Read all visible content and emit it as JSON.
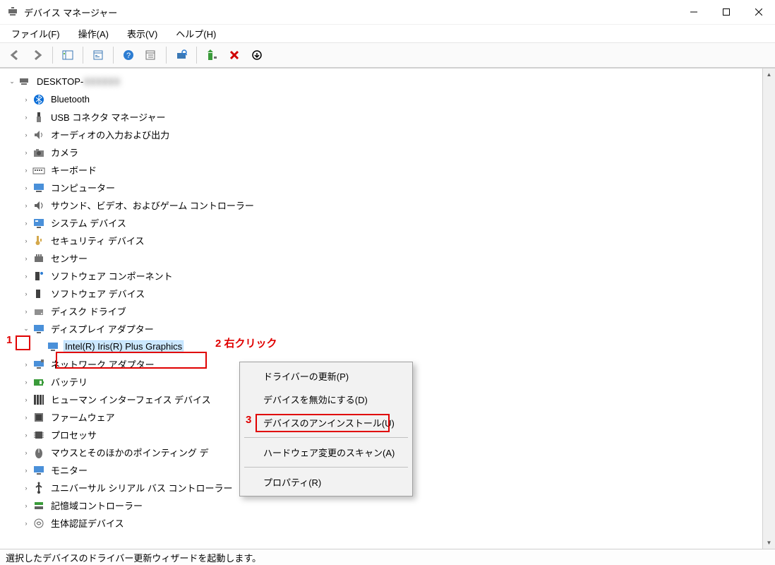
{
  "titlebar": {
    "title": "デバイス マネージャー"
  },
  "menubar": {
    "file": "ファイル(F)",
    "action": "操作(A)",
    "view": "表示(V)",
    "help": "ヘルプ(H)"
  },
  "tree": {
    "root": {
      "label": "DESKTOP-",
      "suffix_hidden": "XXXXXX"
    },
    "items": [
      {
        "label": "Bluetooth",
        "icon": "bluetooth"
      },
      {
        "label": "USB コネクタ マネージャー",
        "icon": "usb"
      },
      {
        "label": "オーディオの入力および出力",
        "icon": "audio"
      },
      {
        "label": "カメラ",
        "icon": "camera"
      },
      {
        "label": "キーボード",
        "icon": "keyboard"
      },
      {
        "label": "コンピューター",
        "icon": "computer"
      },
      {
        "label": "サウンド、ビデオ、およびゲーム コントローラー",
        "icon": "sound"
      },
      {
        "label": "システム デバイス",
        "icon": "system"
      },
      {
        "label": "セキュリティ デバイス",
        "icon": "security"
      },
      {
        "label": "センサー",
        "icon": "sensor"
      },
      {
        "label": "ソフトウェア コンポーネント",
        "icon": "swcomponent"
      },
      {
        "label": "ソフトウェア デバイス",
        "icon": "swdevice"
      },
      {
        "label": "ディスク ドライブ",
        "icon": "disk"
      },
      {
        "label": "ディスプレイ アダプター",
        "icon": "display",
        "expanded": true,
        "children": [
          {
            "label": "Intel(R) Iris(R) Plus Graphics",
            "icon": "display",
            "selected": true
          }
        ]
      },
      {
        "label": "ネットワーク アダプター",
        "icon": "network"
      },
      {
        "label": "バッテリ",
        "icon": "battery"
      },
      {
        "label": "ヒューマン インターフェイス デバイス",
        "icon": "hid"
      },
      {
        "label": "ファームウェア",
        "icon": "firmware"
      },
      {
        "label": "プロセッサ",
        "icon": "cpu"
      },
      {
        "label": "マウスとそのほかのポインティング デバイス",
        "icon": "mouse",
        "truncated": "マウスとそのほかのポインティング デ"
      },
      {
        "label": "モニター",
        "icon": "monitor"
      },
      {
        "label": "ユニバーサル シリアル バス コントローラー",
        "icon": "usbctrl"
      },
      {
        "label": "記憶域コントローラー",
        "icon": "storage"
      },
      {
        "label": "生体認証デバイス",
        "icon": "biometric",
        "truncated": "生体認証デバイス"
      }
    ]
  },
  "context_menu": {
    "update_driver": "ドライバーの更新(P)",
    "disable_device": "デバイスを無効にする(D)",
    "uninstall_device": "デバイスのアンインストール(U)",
    "scan_changes": "ハードウェア変更のスキャン(A)",
    "properties": "プロパティ(R)"
  },
  "statusbar": {
    "text": "選択したデバイスのドライバー更新ウィザードを起動します。"
  },
  "annotations": {
    "step1": "1",
    "step2": "2 右クリック",
    "step3": "3"
  }
}
